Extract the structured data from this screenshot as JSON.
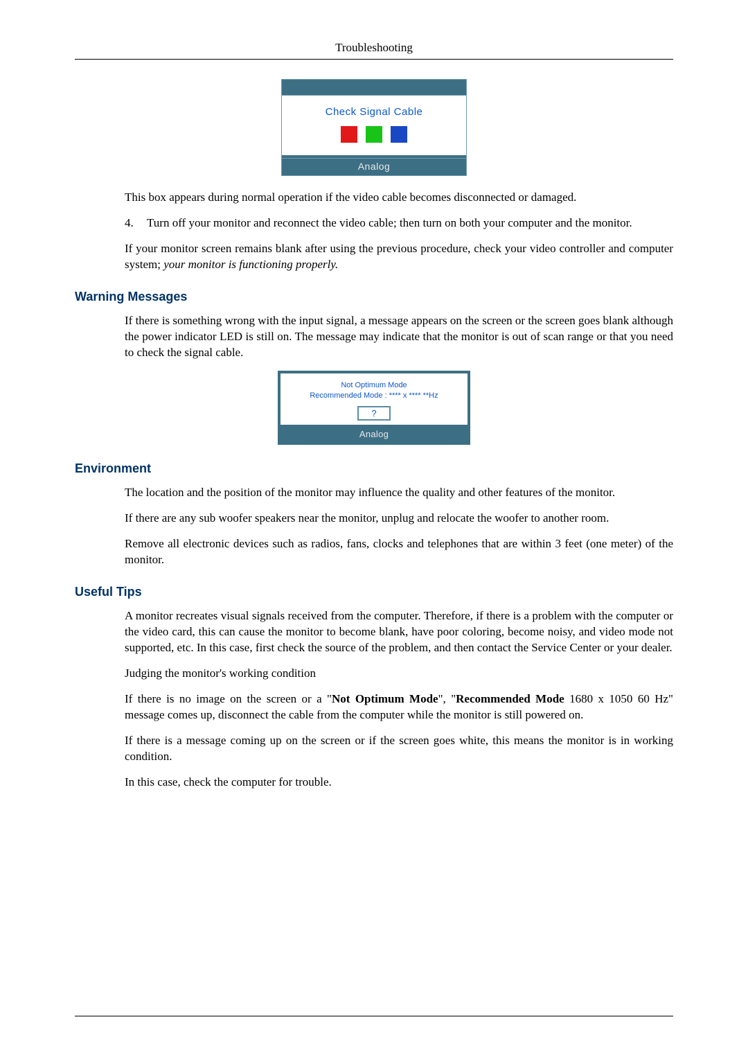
{
  "header": {
    "title": "Troubleshooting"
  },
  "osd1": {
    "title": "Check Signal Cable",
    "footer": "Analog"
  },
  "body": {
    "p_box_appears": "This box appears during normal operation if the video cable becomes disconnected or damaged.",
    "li4_num": "4.",
    "li4_text": "Turn off your monitor and reconnect the video cable; then turn on both your computer and the monitor.",
    "p_remains_blank_1": "If your monitor screen remains blank after using the previous procedure, check your video controller and computer system; ",
    "p_remains_blank_2": "your monitor is functioning properly."
  },
  "sect_warning": {
    "heading": "Warning Messages",
    "p1": "If there is something wrong with the input signal, a message appears on the screen or the screen goes blank although the power indicator LED is still on. The message may indicate that the monitor is out of scan range or that you need to check the signal cable."
  },
  "osd2": {
    "line1": "Not Optimum Mode",
    "line2": "Recommended Mode : **** x ****  **Hz",
    "qmark": "?",
    "footer": "Analog"
  },
  "sect_env": {
    "heading": "Environment",
    "p1": "The location and the position of the monitor may influence the quality and other features of the monitor.",
    "p2": "If there are any sub woofer speakers near the monitor, unplug and relocate the woofer to another room.",
    "p3": "Remove all electronic devices such as radios, fans, clocks and telephones that are within 3 feet (one meter) of the monitor."
  },
  "sect_tips": {
    "heading": "Useful Tips",
    "p1": "A monitor recreates visual signals received from the computer. Therefore, if there is a problem with the computer or the video card, this can cause the monitor to become blank, have poor coloring, become noisy, and video mode not supported, etc. In this case, first check the source of the problem, and then contact the Service Center or your dealer.",
    "p2": "Judging the monitor's working condition",
    "p3_a": "If there is no image on the screen or a \"",
    "p3_b": "Not Optimum Mode",
    "p3_c": "\", \"",
    "p3_d": "Recommended Mode",
    "p3_e": " 1680 x 1050 60 Hz\" message comes up, disconnect the cable from the computer while the monitor is still powered on.",
    "p4": "If there is a message coming up on the screen or if the screen goes white, this means the monitor is in working condition.",
    "p5": "In this case, check the computer for trouble."
  }
}
